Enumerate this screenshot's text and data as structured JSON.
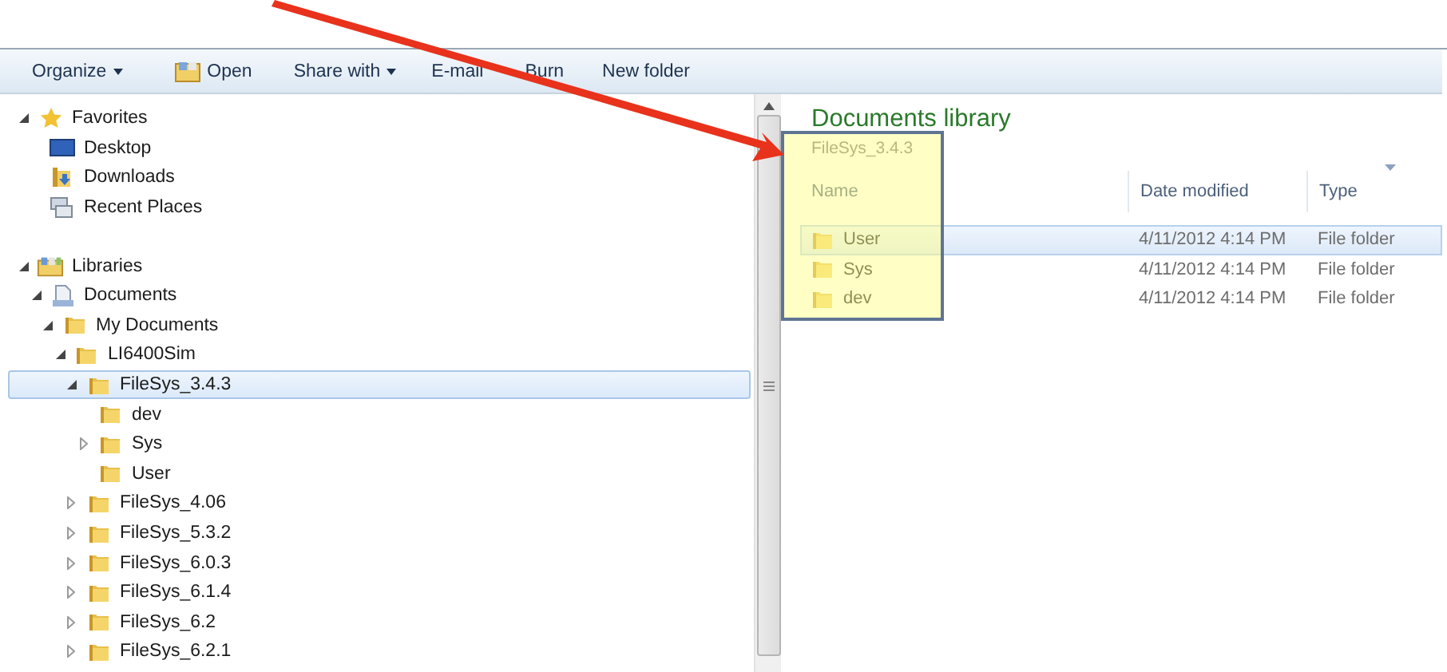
{
  "toolbar": [
    {
      "label": "Organize",
      "kind": "menu"
    },
    {
      "label": "Open",
      "kind": "icon"
    },
    {
      "label": "Share with",
      "kind": "menu"
    },
    {
      "label": "E-mail",
      "kind": "plain"
    },
    {
      "label": "Burn",
      "kind": "plain"
    },
    {
      "label": "New folder",
      "kind": "plain"
    }
  ],
  "tree": [
    {
      "label": "Favorites",
      "kind": "star",
      "expanded": true,
      "selected": false,
      "children": [
        {
          "label": "Desktop",
          "kind": "desktop",
          "selected": false
        },
        {
          "label": "Downloads",
          "kind": "downloads",
          "selected": false
        },
        {
          "label": "Recent Places",
          "kind": "recent",
          "selected": false
        }
      ]
    },
    {
      "label": "Libraries",
      "kind": "libraries",
      "expanded": true,
      "selected": false,
      "children": [
        {
          "label": "Documents",
          "kind": "documents",
          "expanded": true,
          "selected": false,
          "children": [
            {
              "label": "My Documents",
              "kind": "folder",
              "expanded": true,
              "selected": false,
              "children": [
                {
                  "label": "LI6400Sim",
                  "kind": "folder",
                  "expanded": true,
                  "selected": false,
                  "children": [
                    {
                      "label": "FileSys_3.4.3",
                      "kind": "folder",
                      "expanded": true,
                      "selected": true,
                      "children": [
                        {
                          "label": "dev",
                          "kind": "folder",
                          "selected": false
                        },
                        {
                          "label": "Sys",
                          "kind": "folder",
                          "expanded": false,
                          "selected": false
                        },
                        {
                          "label": "User",
                          "kind": "folder",
                          "selected": false
                        }
                      ]
                    },
                    {
                      "label": "FileSys_4.06",
                      "kind": "folder",
                      "expanded": false,
                      "selected": false
                    },
                    {
                      "label": "FileSys_5.3.2",
                      "kind": "folder",
                      "expanded": false,
                      "selected": false
                    },
                    {
                      "label": "FileSys_6.0.3",
                      "kind": "folder",
                      "expanded": false,
                      "selected": false
                    },
                    {
                      "label": "FileSys_6.1.4",
                      "kind": "folder",
                      "expanded": false,
                      "selected": false
                    },
                    {
                      "label": "FileSys_6.2",
                      "kind": "folder",
                      "expanded": false,
                      "selected": false
                    },
                    {
                      "label": "FileSys_6.2.1",
                      "kind": "folder",
                      "expanded": false,
                      "selected": false
                    }
                  ]
                }
              ]
            }
          ]
        }
      ]
    }
  ],
  "library": {
    "title": "Documents library",
    "subtitle": "FileSys_3.4.3",
    "columns": [
      "Name",
      "Date modified",
      "Type"
    ],
    "rows": [
      {
        "name": "User",
        "date": "4/11/2012 4:14 PM",
        "type": "File folder",
        "selected": true
      },
      {
        "name": "Sys",
        "date": "4/11/2012 4:14 PM",
        "type": "File folder",
        "selected": false
      },
      {
        "name": "dev",
        "date": "4/11/2012 4:14 PM",
        "type": "File folder",
        "selected": false
      }
    ]
  }
}
